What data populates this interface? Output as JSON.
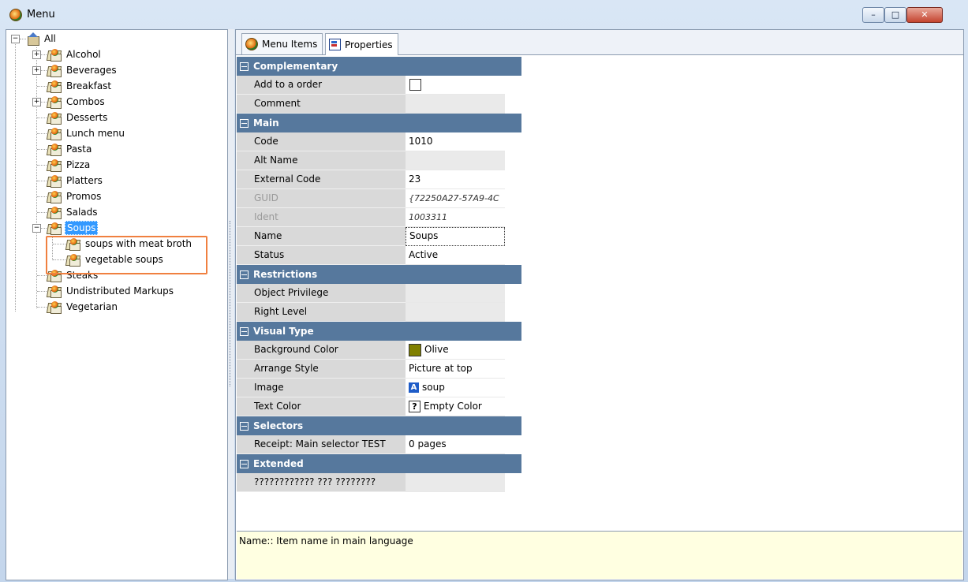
{
  "window": {
    "title": "Menu",
    "buttons": {
      "minimize": "–",
      "maximize": "□",
      "close": "✕"
    }
  },
  "tree": {
    "root": "All",
    "items": [
      {
        "label": "Alcohol",
        "expander": "+"
      },
      {
        "label": "Beverages",
        "expander": "+"
      },
      {
        "label": "Breakfast",
        "expander": ""
      },
      {
        "label": "Combos",
        "expander": "+"
      },
      {
        "label": "Desserts",
        "expander": ""
      },
      {
        "label": "Lunch menu",
        "expander": ""
      },
      {
        "label": "Pasta",
        "expander": ""
      },
      {
        "label": "Pizza",
        "expander": ""
      },
      {
        "label": "Platters",
        "expander": ""
      },
      {
        "label": "Promos",
        "expander": ""
      },
      {
        "label": "Salads",
        "expander": ""
      },
      {
        "label": "Soups",
        "expander": "−",
        "selected": true
      },
      {
        "label": "soups with meat broth",
        "child": true
      },
      {
        "label": "vegetable soups",
        "child": true
      },
      {
        "label": "Steaks",
        "expander": ""
      },
      {
        "label": "Undistributed Markups",
        "expander": ""
      },
      {
        "label": "Vegetarian",
        "expander": ""
      }
    ]
  },
  "tabs": [
    {
      "label": "Menu Items",
      "icon": "apple-icon"
    },
    {
      "label": "Properties",
      "icon": "properties-icon",
      "active": true
    }
  ],
  "properties": {
    "complementary": {
      "title": "Complementary",
      "rows": [
        {
          "label": "Add to a order",
          "value": ""
        },
        {
          "label": "Comment",
          "value": ""
        }
      ]
    },
    "main": {
      "title": "Main",
      "rows": [
        {
          "label": "Code",
          "value": "1010"
        },
        {
          "label": "Alt Name",
          "value": ""
        },
        {
          "label": "External Code",
          "value": "23"
        },
        {
          "label": "GUID",
          "value": "{72250A27-57A9-4C"
        },
        {
          "label": "Ident",
          "value": "1003311"
        },
        {
          "label": "Name",
          "value": "Soups"
        },
        {
          "label": "Status",
          "value": "Active"
        }
      ]
    },
    "restrictions": {
      "title": "Restrictions",
      "rows": [
        {
          "label": "Object Privilege",
          "value": ""
        },
        {
          "label": "Right Level",
          "value": ""
        }
      ]
    },
    "visual": {
      "title": "Visual Type",
      "rows": [
        {
          "label": "Background Color",
          "value": "Olive",
          "color": "#808000"
        },
        {
          "label": "Arrange Style",
          "value": "Picture at top"
        },
        {
          "label": "Image",
          "value": "soup"
        },
        {
          "label": "Text Color",
          "value": "Empty Color"
        }
      ]
    },
    "selectors": {
      "title": "Selectors",
      "rows": [
        {
          "label": "Receipt: Main selector TEST",
          "value": "0 pages"
        }
      ]
    },
    "extended": {
      "title": "Extended",
      "rows": [
        {
          "label": "???????????? ??? ????????",
          "value": ""
        }
      ]
    }
  },
  "description": "Name:: Item name in main language",
  "colors": {
    "section_header": "#56789d",
    "selection": "#3399ff",
    "highlight": "#f08040",
    "olive": "#808000",
    "description_bg": "#ffffe1"
  }
}
